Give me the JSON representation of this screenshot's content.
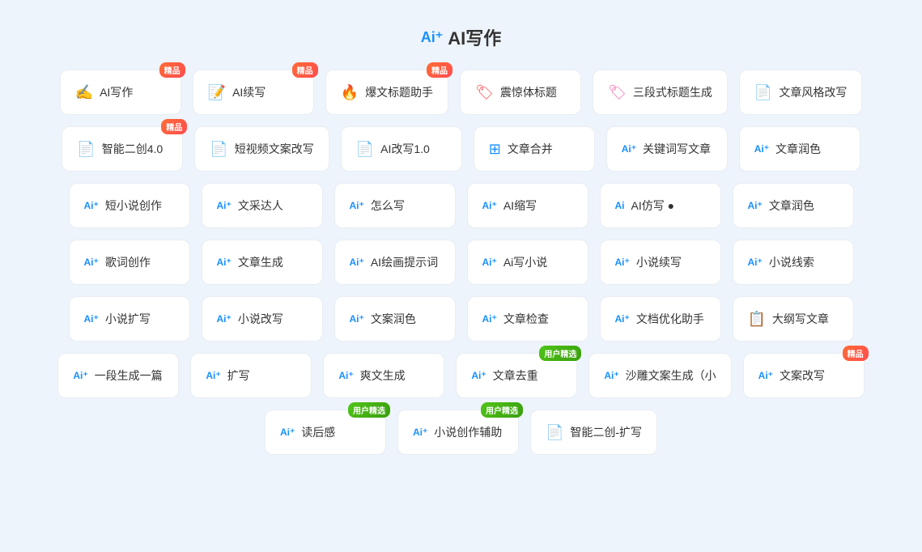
{
  "title": {
    "logo": "Ai⁺",
    "text": "AI写作"
  },
  "cards": [
    {
      "id": "ai-writing",
      "prefix": "",
      "icon": "✍",
      "iconColor": "icon-orange",
      "label": "AI写作",
      "badge": "精品",
      "badgeType": "jingpin"
    },
    {
      "id": "ai-continue",
      "prefix": "",
      "icon": "📝",
      "iconColor": "icon-blue",
      "label": "AI续写",
      "badge": "精品",
      "badgeType": "jingpin"
    },
    {
      "id": "headline-helper",
      "prefix": "",
      "icon": "🔥",
      "iconColor": "icon-red",
      "label": "爆文标题助手",
      "badge": "精品",
      "badgeType": "jingpin"
    },
    {
      "id": "shocking-title",
      "prefix": "",
      "icon": "🏷",
      "iconColor": "icon-red",
      "label": "震惊体标题",
      "badge": null
    },
    {
      "id": "three-title",
      "prefix": "",
      "icon": "🏷",
      "iconColor": "icon-pink",
      "label": "三段式标题生成",
      "badge": null
    },
    {
      "id": "style-rewrite",
      "prefix": "",
      "icon": "📄",
      "iconColor": "icon-orange",
      "label": "文章风格改写",
      "badge": null
    },
    {
      "id": "smart-second",
      "prefix": "",
      "icon": "📄",
      "iconColor": "icon-orange",
      "label": "智能二创4.0",
      "badge": "精品",
      "badgeType": "jingpin"
    },
    {
      "id": "short-video-copy",
      "prefix": "",
      "icon": "📄",
      "iconColor": "icon-orange",
      "label": "短视频文案改写",
      "badge": null
    },
    {
      "id": "ai-rewrite",
      "prefix": "",
      "icon": "📄",
      "iconColor": "icon-orange",
      "label": "AI改写1.0",
      "badge": null
    },
    {
      "id": "article-merge",
      "prefix": "",
      "icon": "⊞",
      "iconColor": "icon-blue",
      "label": "文章合并",
      "badge": null
    },
    {
      "id": "keyword-write",
      "prefix": "Ai⁺",
      "icon": null,
      "iconColor": "",
      "label": "关键词写文章",
      "badge": null
    },
    {
      "id": "article-polish",
      "prefix": "Ai⁺",
      "icon": null,
      "iconColor": "",
      "label": "文章润色",
      "badge": null
    },
    {
      "id": "short-novel",
      "prefix": "Ai⁺",
      "icon": null,
      "iconColor": "",
      "label": "短小说创作",
      "badge": null
    },
    {
      "id": "writing-talent",
      "prefix": "Ai⁺",
      "icon": null,
      "iconColor": "",
      "label": "文采达人",
      "badge": null
    },
    {
      "id": "how-to-write",
      "prefix": "Ai⁺",
      "icon": null,
      "iconColor": "",
      "label": "怎么写",
      "badge": null
    },
    {
      "id": "ai-compress",
      "prefix": "Ai⁺",
      "icon": null,
      "iconColor": "",
      "label": "AI缩写",
      "badge": null
    },
    {
      "id": "ai-imitate",
      "prefix": "Ai",
      "icon": null,
      "iconColor": "",
      "label": "AI仿写 ●",
      "badge": null
    },
    {
      "id": "article-polish2",
      "prefix": "Ai⁺",
      "icon": null,
      "iconColor": "",
      "label": "文章润色",
      "badge": null
    },
    {
      "id": "lyric-create",
      "prefix": "Ai⁺",
      "icon": null,
      "iconColor": "",
      "label": "歌词创作",
      "badge": null
    },
    {
      "id": "article-gen",
      "prefix": "Ai⁺",
      "icon": null,
      "iconColor": "",
      "label": "文章生成",
      "badge": null
    },
    {
      "id": "ai-paint-prompt",
      "prefix": "Ai⁺",
      "icon": null,
      "iconColor": "",
      "label": "AI绘画提示词",
      "badge": null
    },
    {
      "id": "ai-write-novel",
      "prefix": "Ai⁺",
      "icon": null,
      "iconColor": "",
      "label": "Ai写小说",
      "badge": null
    },
    {
      "id": "novel-continue",
      "prefix": "Ai⁺",
      "icon": null,
      "iconColor": "",
      "label": "小说续写",
      "badge": null
    },
    {
      "id": "novel-clue",
      "prefix": "Ai⁺",
      "icon": null,
      "iconColor": "",
      "label": "小说线索",
      "badge": null
    },
    {
      "id": "novel-expand",
      "prefix": "Ai⁺",
      "icon": null,
      "iconColor": "",
      "label": "小说扩写",
      "badge": null
    },
    {
      "id": "novel-rewrite",
      "prefix": "Ai⁺",
      "icon": null,
      "iconColor": "",
      "label": "小说改写",
      "badge": null
    },
    {
      "id": "copy-polish",
      "prefix": "Ai⁺",
      "icon": null,
      "iconColor": "",
      "label": "文案润色",
      "badge": null
    },
    {
      "id": "article-check",
      "prefix": "Ai⁺",
      "icon": null,
      "iconColor": "",
      "label": "文章检查",
      "badge": null
    },
    {
      "id": "doc-optimize",
      "prefix": "Ai⁺",
      "icon": null,
      "iconColor": "",
      "label": "文档优化助手",
      "badge": null
    },
    {
      "id": "outline-write",
      "prefix": "",
      "icon": "📋",
      "iconColor": "icon-blue",
      "label": "大纲写文章",
      "badge": null
    },
    {
      "id": "one-para",
      "prefix": "Ai⁺",
      "icon": null,
      "iconColor": "",
      "label": "一段生成一篇",
      "badge": null
    },
    {
      "id": "expand-write",
      "prefix": "Ai⁺",
      "icon": null,
      "iconColor": "",
      "label": "扩写",
      "badge": null
    },
    {
      "id": "fun-gen",
      "prefix": "Ai⁺",
      "icon": null,
      "iconColor": "",
      "label": "爽文生成",
      "badge": null
    },
    {
      "id": "article-dedup",
      "prefix": "Ai⁺",
      "icon": null,
      "iconColor": "",
      "label": "文章去重",
      "badge": "用户精选",
      "badgeType": "user"
    },
    {
      "id": "sha-copy-gen",
      "prefix": "Ai⁺",
      "icon": null,
      "iconColor": "",
      "label": "沙雕文案生成（小",
      "badge": null
    },
    {
      "id": "copy-rewrite",
      "prefix": "Ai⁺",
      "icon": null,
      "iconColor": "",
      "label": "文案改写",
      "badge": "精品",
      "badgeType": "jingpin"
    },
    {
      "id": "reading-notes",
      "prefix": "Ai⁺",
      "icon": null,
      "iconColor": "",
      "label": "读后感",
      "badge": "用户精选",
      "badgeType": "user"
    },
    {
      "id": "novel-assist",
      "prefix": "Ai⁺",
      "icon": null,
      "iconColor": "",
      "label": "小说创作辅助",
      "badge": "用户精选",
      "badgeType": "user"
    },
    {
      "id": "smart-second2",
      "prefix": "",
      "icon": "📄",
      "iconColor": "icon-orange",
      "label": "智能二创-扩写",
      "badge": null
    }
  ]
}
